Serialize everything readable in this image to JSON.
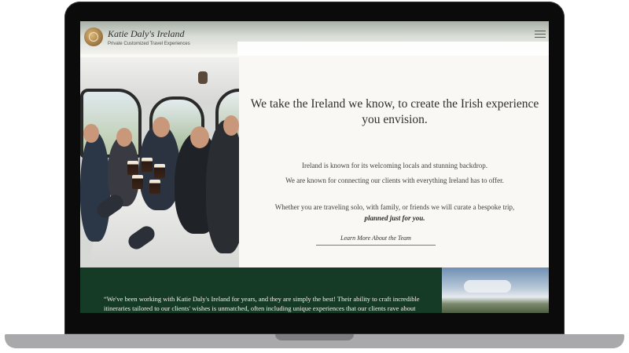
{
  "site": {
    "brand_name": "Katie Daly's Ireland",
    "tagline": "Private Customized Travel Experiences"
  },
  "header": {
    "menu_icon": "hamburger-menu-icon"
  },
  "intro": {
    "title": "We take the Ireland we know, to create the Irish experience you envision.",
    "paragraph_1": "Ireland is known for its welcoming locals and stunning backdrop.",
    "paragraph_2": "We are known for connecting our clients with everything Ireland has to offer.",
    "paragraph_3_start": "Whether you are traveling solo, with family, or friends we will curate a bespoke trip,",
    "paragraph_3_emphasis": "planned just for you.",
    "cta_label": "Learn More About the Team"
  },
  "testimonial": {
    "quote": "“We've been working with Katie Daly's Ireland for years, and they are simply the best! Their ability to craft incredible itineraries tailored to our clients' wishes is unmatched, often including unique experiences that our clients rave about"
  },
  "colors": {
    "testimonial_bg": "#153a26",
    "page_bg": "#faf8f4",
    "laptop_frame": "#0b0b0b"
  }
}
